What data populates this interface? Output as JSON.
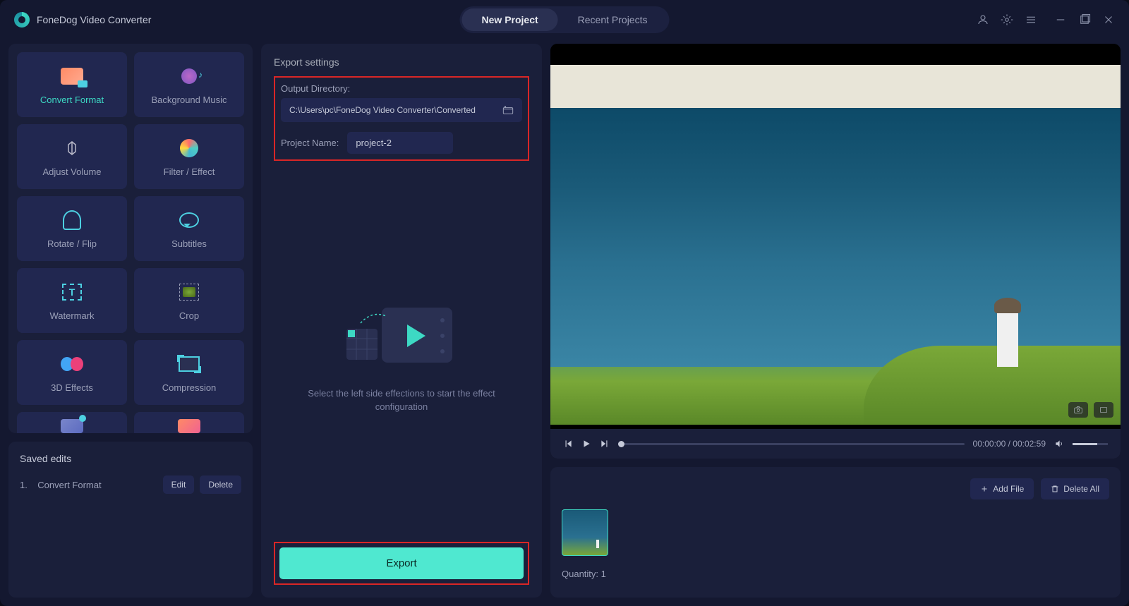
{
  "app": {
    "title": "FoneDog Video Converter"
  },
  "tabs": {
    "new_project": "New Project",
    "recent_projects": "Recent Projects"
  },
  "tools": {
    "convert_format": "Convert Format",
    "background_music": "Background Music",
    "adjust_volume": "Adjust Volume",
    "filter_effect": "Filter / Effect",
    "rotate_flip": "Rotate / Flip",
    "subtitles": "Subtitles",
    "watermark": "Watermark",
    "crop": "Crop",
    "three_d_effects": "3D Effects",
    "compression": "Compression"
  },
  "saved": {
    "title": "Saved edits",
    "items": [
      {
        "index": "1.",
        "label": "Convert Format"
      }
    ],
    "edit": "Edit",
    "delete": "Delete"
  },
  "export": {
    "section_title": "Export settings",
    "output_dir_label": "Output Directory:",
    "output_dir_value": "C:\\Users\\pc\\FoneDog Video Converter\\Converted",
    "project_name_label": "Project Name:",
    "project_name_value": "project-2",
    "placeholder_text": "Select the left side effections to start the effect configuration",
    "button": "Export"
  },
  "player": {
    "current_time": "00:00:00",
    "total_time": "00:02:59",
    "separator": " / "
  },
  "files": {
    "add_file": "Add File",
    "delete_all": "Delete All",
    "quantity_label": "Quantity: ",
    "quantity_value": "1"
  }
}
